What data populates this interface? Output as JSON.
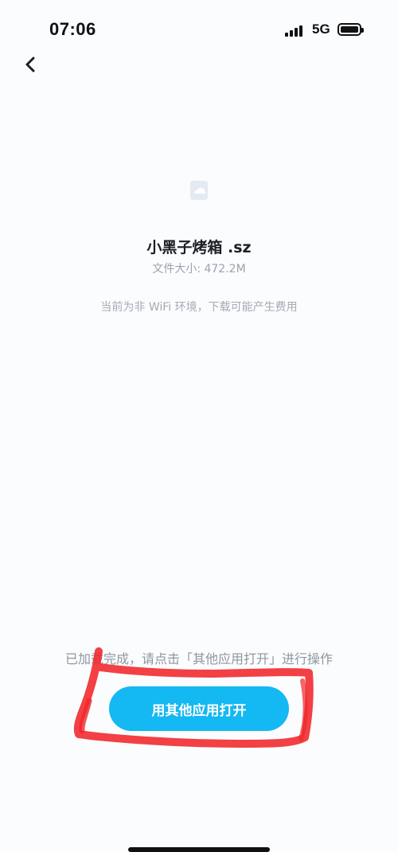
{
  "status_bar": {
    "time": "07:06",
    "network": "5G",
    "icons": [
      "signal-icon",
      "battery-icon"
    ]
  },
  "nav": {
    "back_icon": "chevron-left-icon"
  },
  "file": {
    "icon": "cloud-file-icon",
    "name": "小黑子烤箱 .sz",
    "size_label": "文件大小: 472.2M"
  },
  "notices": {
    "network_warning": "当前为非 WiFi 环境，下载可能产生费用",
    "loaded_hint": "已加载完成，请点击「其他应用打开」进行操作"
  },
  "actions": {
    "open_with_other_app": "用其他应用打开"
  },
  "colors": {
    "accent": "#14b8f2",
    "annotation": "#f0262a",
    "background": "#fbfcfe"
  }
}
